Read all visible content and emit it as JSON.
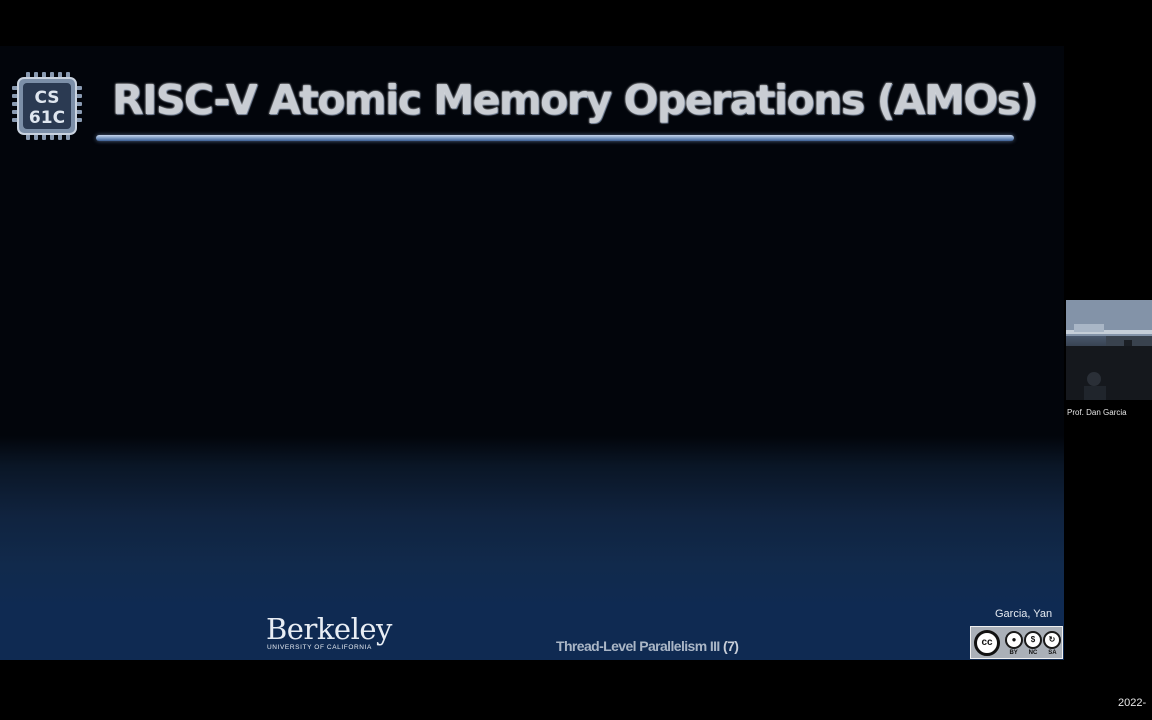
{
  "slide": {
    "logo_text_top": "CS",
    "logo_text_bottom": "61C",
    "title": "RISC-V Atomic Memory Operations (AMOs)",
    "footer_lecture": "Thread-Level Parallelism III",
    "footer_page": "(7)",
    "authors": "Garcia, Yan",
    "berkeley_word": "Berkeley",
    "berkeley_sub": "UNIVERSITY OF CALIFORNIA",
    "license": {
      "cc": "cc",
      "by": "BY",
      "nc": "NC",
      "sa": "SA"
    }
  },
  "participant": {
    "name": "Prof. Dan Garcia"
  },
  "timestamp": "2022-",
  "colors": {
    "title": "#c9cdd3",
    "underline": "#7f9cc6",
    "slide_bottom": "#0f2a52",
    "logo_chip": "#7c8fa8"
  },
  "icons": [
    "cs61c-chip-logo",
    "creative-commons-icon",
    "attribution-icon",
    "noncommercial-icon",
    "sharealike-icon"
  ]
}
